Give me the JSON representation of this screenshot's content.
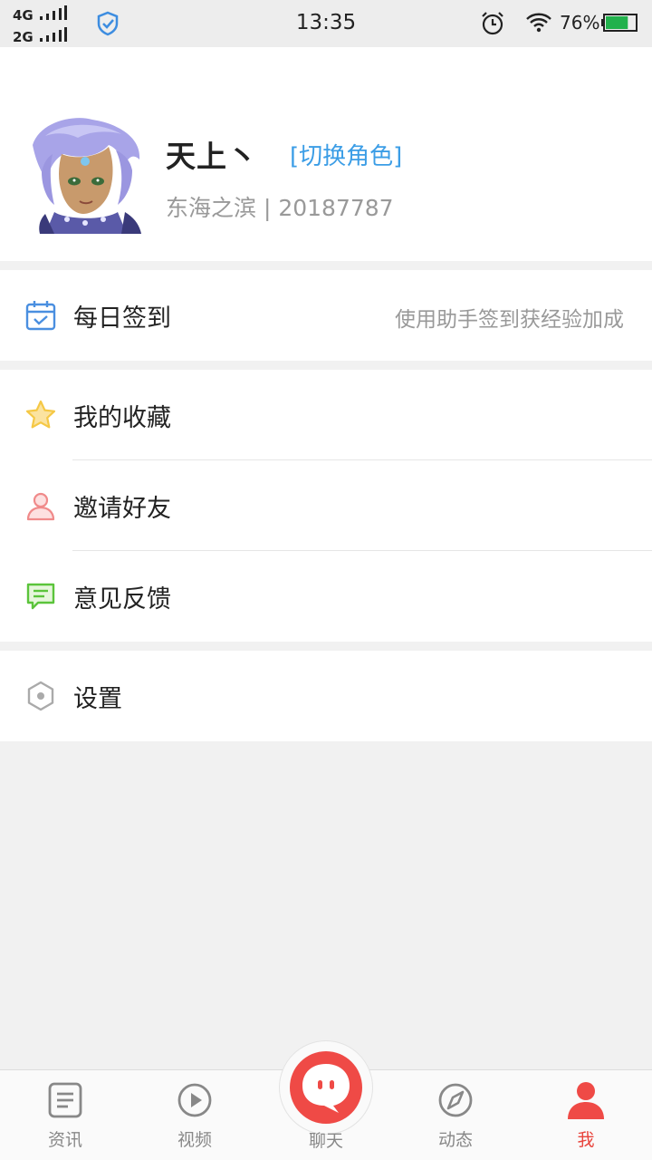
{
  "status_bar": {
    "network_1": "4G",
    "network_2": "2G",
    "time": "13:35",
    "battery_percent": "76%",
    "battery_level": 0.76
  },
  "profile": {
    "name": "天上丶",
    "switch_role_label": "[切换角色]",
    "server_info": "东海之滨 | 20187787"
  },
  "menu": {
    "daily_checkin": {
      "label": "每日签到",
      "hint": "使用助手签到获经验加成",
      "icon": "calendar-check-icon"
    },
    "favorites": {
      "label": "我的收藏",
      "icon": "star-icon"
    },
    "invite": {
      "label": "邀请好友",
      "icon": "person-icon"
    },
    "feedback": {
      "label": "意见反馈",
      "icon": "chat-message-icon"
    },
    "settings": {
      "label": "设置",
      "icon": "hexagon-gear-icon"
    }
  },
  "tabs": [
    {
      "label": "资讯",
      "icon": "news-icon",
      "active": false
    },
    {
      "label": "视频",
      "icon": "play-icon",
      "active": false
    },
    {
      "label": "聊天",
      "icon": "chat-bubble-icon",
      "active": false
    },
    {
      "label": "动态",
      "icon": "compass-icon",
      "active": false
    },
    {
      "label": "我",
      "icon": "user-icon",
      "active": true
    }
  ],
  "colors": {
    "accent_red": "#e8443c",
    "link_blue": "#3b9de6",
    "star_yellow": "#f5c845",
    "feedback_green": "#5bc43b",
    "invite_red": "#f08a8a",
    "calendar_blue": "#4a8fe0"
  }
}
